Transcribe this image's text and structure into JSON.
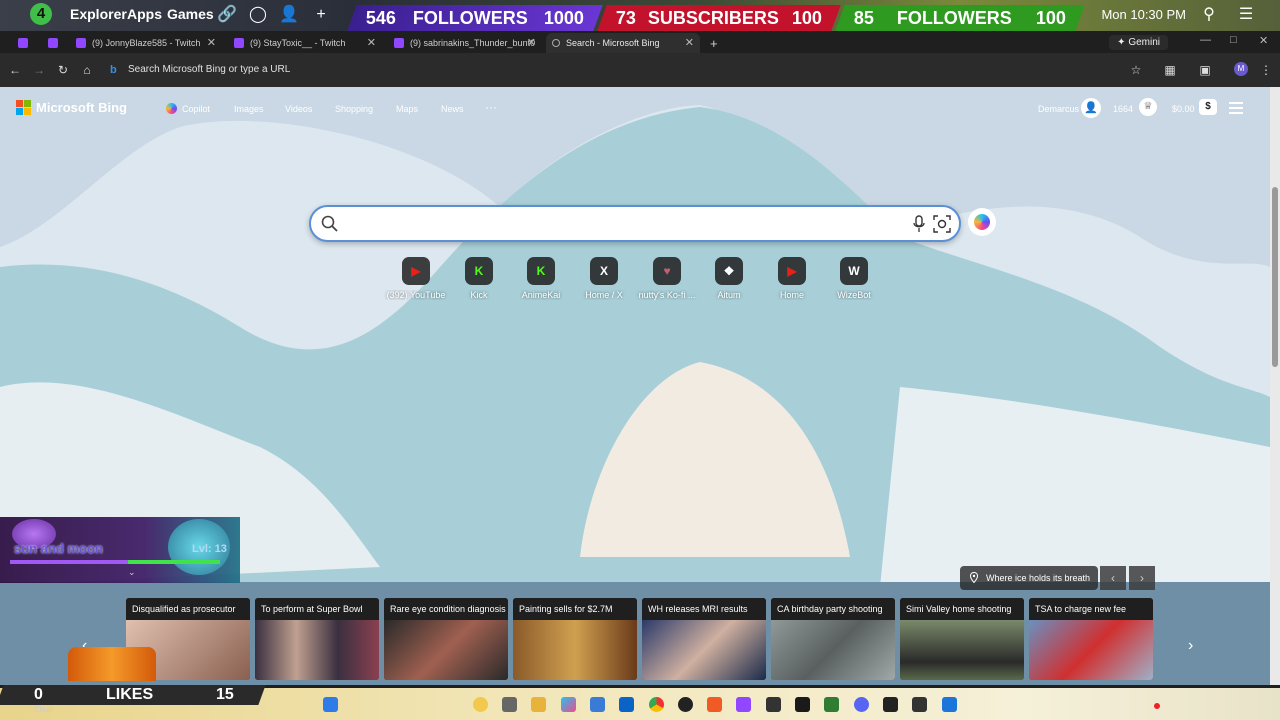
{
  "overlay_top": {
    "workspace_number": "4",
    "menu": [
      "Explorer",
      "Apps",
      "Games"
    ],
    "goals": [
      {
        "current": "546",
        "label": "FOLLOWERS",
        "target": "1000",
        "color": "#6a36d4"
      },
      {
        "current": "73",
        "label": "SUBSCRIBERS",
        "target": "100",
        "color": "#c3122b"
      },
      {
        "current": "85",
        "label": "FOLLOWERS",
        "target": "100",
        "color": "#2e9a1f"
      }
    ],
    "clock": "Mon 10:30 PM"
  },
  "browser": {
    "tabs": [
      {
        "label": "(9) JonnyBlaze585 - Twitch",
        "icon": "twitch-icon"
      },
      {
        "label": "(9) StayToxic__ - Twitch",
        "icon": "twitch-icon"
      },
      {
        "label": "(9) sabrinakins_Thunder_bunt0",
        "icon": "twitch-icon"
      },
      {
        "label": "Search - Microsoft Bing",
        "icon": "bing-icon",
        "active": true
      }
    ],
    "gemini_label": "Gemini",
    "address_placeholder": "Search Microsoft Bing or type a URL"
  },
  "bing": {
    "logo": "Microsoft Bing",
    "nav": [
      "Copilot",
      "Images",
      "Videos",
      "Shopping",
      "Maps",
      "News",
      "···"
    ],
    "user_name": "Demarcus",
    "points": "1664",
    "balance": "$0.00",
    "search_placeholder": "",
    "quick_links": [
      {
        "label": "(392) YouTube",
        "icon": "youtube-icon",
        "color": "#e62117"
      },
      {
        "label": "Kick",
        "icon": "kick-icon",
        "color": "#53fc18"
      },
      {
        "label": "AnimeKai",
        "icon": "animekai-icon",
        "color": "#53fc18"
      },
      {
        "label": "Home / X",
        "icon": "x-icon",
        "color": "#ffffff"
      },
      {
        "label": "nutty's Ko-fi ...",
        "icon": "kofi-icon",
        "color": "#c06070"
      },
      {
        "label": "Aitum",
        "icon": "aitum-icon",
        "color": "#ffffff"
      },
      {
        "label": "Home",
        "icon": "youtube-icon",
        "color": "#e62117"
      },
      {
        "label": "WizeBot",
        "icon": "wizebot-icon",
        "color": "#ffffff"
      }
    ],
    "image_caption": "Where ice holds its breath",
    "news": [
      {
        "title": "Disqualified as prosecutor",
        "color": "#a07868"
      },
      {
        "title": "To perform at Super Bowl",
        "color": "#5a5060"
      },
      {
        "title": "Rare eye condition diagnosis",
        "color": "#703a30"
      },
      {
        "title": "Painting sells for $2.7M",
        "color": "#6a4a2a"
      },
      {
        "title": "WH releases MRI results",
        "color": "#2a3a5a"
      },
      {
        "title": "CA birthday party shooting",
        "color": "#6a7070"
      },
      {
        "title": "Simi Valley home shooting",
        "color": "#4a5a3a"
      },
      {
        "title": "TSA to charge new fee",
        "color": "#5a7090"
      }
    ]
  },
  "stream_overlay": {
    "label": "sun and moon",
    "level": "Lvl: 13",
    "likes_count": "0",
    "likes_label": "LIKES",
    "likes_target": "15",
    "clear_label": "Clear"
  },
  "taskbar": {
    "icons": [
      "windows-start-icon",
      "copilot-icon",
      "taskview-icon",
      "file-explorer-icon",
      "copilot-app-icon",
      "store-icon",
      "outlook-icon",
      "chrome-icon",
      "obs-icon",
      "brave-icon",
      "firefox-icon",
      "twitch-studio-icon",
      "streamer-app-icon",
      "terminal-icon",
      "sheets-icon",
      "discord-icon",
      "media-icon",
      "app-icon",
      "settings-icon"
    ]
  }
}
